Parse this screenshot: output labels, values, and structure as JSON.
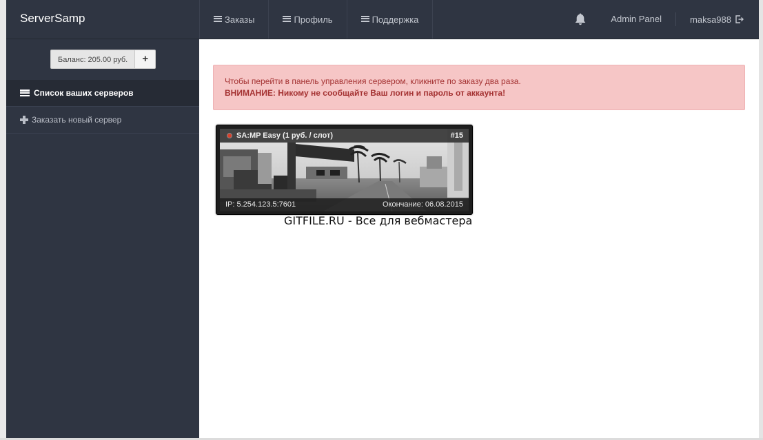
{
  "brand": "ServerSamp",
  "nav": {
    "items": [
      {
        "label": "Заказы",
        "icon": "list-icon"
      },
      {
        "label": "Профиль",
        "icon": "list-icon"
      },
      {
        "label": "Поддержка",
        "icon": "list-icon"
      }
    ],
    "notification_icon": "bell-icon",
    "admin_label": "Admin Panel",
    "username": "maksa988",
    "logout_icon": "logout-icon"
  },
  "sidebar": {
    "balance_label": "Баланс: 205.00 руб.",
    "balance_add": "+",
    "items": [
      {
        "label": "Список ваших серверов",
        "icon": "list-icon",
        "active": true
      },
      {
        "label": "Заказать новый сервер",
        "icon": "plus-icon",
        "active": false
      }
    ]
  },
  "alert": {
    "line1": "Чтобы перейти в панель управления сервером, кликните по заказу два раза.",
    "line2": "ВНИМАНИЕ: Никому не сообщайте Ваш логин и пароль от аккаунта!",
    "color": "#f6c6c6"
  },
  "server": {
    "title": "SA:MP Easy (1 руб. / слот)",
    "id": "#15",
    "ip": "IP: 5.254.123.5:7601",
    "expires": "Окончание: 06.08.2015",
    "status_color": "#d9402b"
  },
  "watermark": "GITFILE.RU - Все для вебмастера"
}
